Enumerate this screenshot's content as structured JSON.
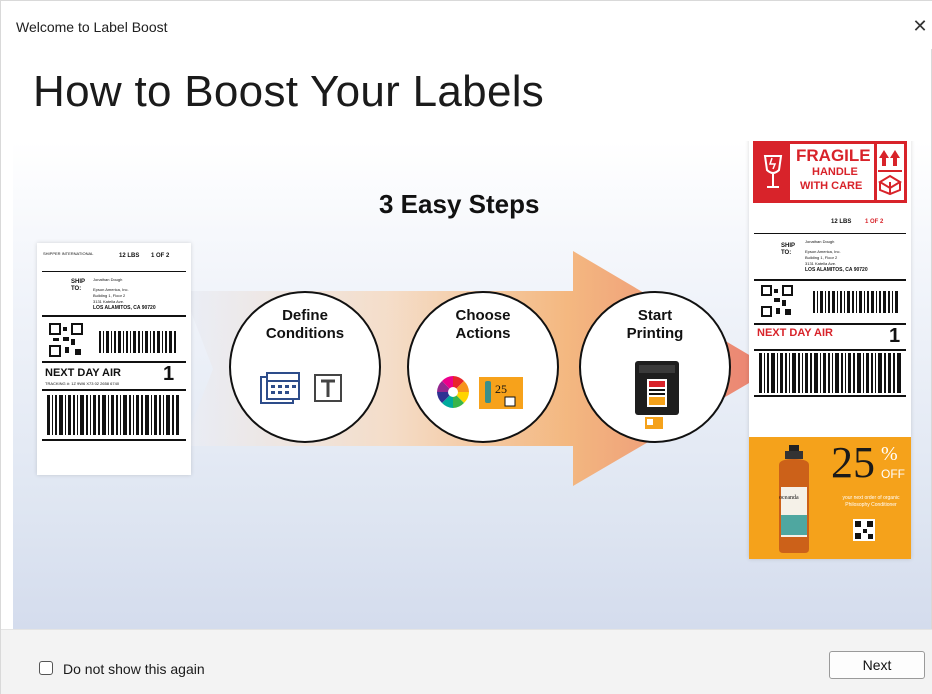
{
  "window": {
    "title": "Welcome to Label Boost",
    "close_glyph": "✕"
  },
  "headline": "How to Boost Your Labels",
  "steps_title": "3 Easy Steps",
  "steps": [
    {
      "line1": "Define",
      "line2": "Conditions",
      "icon": "calendar-and-text-icon"
    },
    {
      "line1": "Choose",
      "line2": "Actions",
      "icon": "color-wheel-and-coupon-icon"
    },
    {
      "line1": "Start",
      "line2": "Printing",
      "icon": "printer-icon"
    }
  ],
  "left_label": {
    "header_small": "SHIPPER INTERNATIONAL",
    "weight": "12 LBS",
    "count": "1 OF 2",
    "ship_to": "SHIP TO:",
    "name": "Jonathan Dough",
    "company": "Epson America, Inc.",
    "address1": "Building 1, Floor 2",
    "address2": "3131 Katella Ave.",
    "city": "LOS ALAMITOS, CA 90720",
    "service": "NEXT DAY AIR",
    "service_number": "1",
    "tracking": "TRACKING #: 1Z 9W6 X73 02 2658 6740"
  },
  "right_label": {
    "fragile": "FRAGILE",
    "handle": "HANDLE",
    "with_care": "WITH CARE",
    "weight": "12 LBS",
    "count": "1 OF 2",
    "ship_to": "SHIP TO:",
    "name": "Jonathan Dough",
    "company": "Epson America, Inc.",
    "address1": "Building 1, Floor 2",
    "address2": "3131 Katella Ave.",
    "city": "LOS ALAMITOS, CA 90720",
    "service": "NEXT DAY AIR",
    "service_number": "1",
    "promo_percent": "25",
    "promo_symbol": "%",
    "promo_off": "OFF",
    "promo_text": "your next order of organic Philosophy Conditioner",
    "product": "oceanda"
  },
  "footer": {
    "checkbox_label": "Do not show this again",
    "checkbox_checked": false,
    "next_label": "Next"
  },
  "colors": {
    "accent_red": "#d8232a",
    "promo_orange": "#f5a21b",
    "arrow_orange": "#f0a35a"
  }
}
